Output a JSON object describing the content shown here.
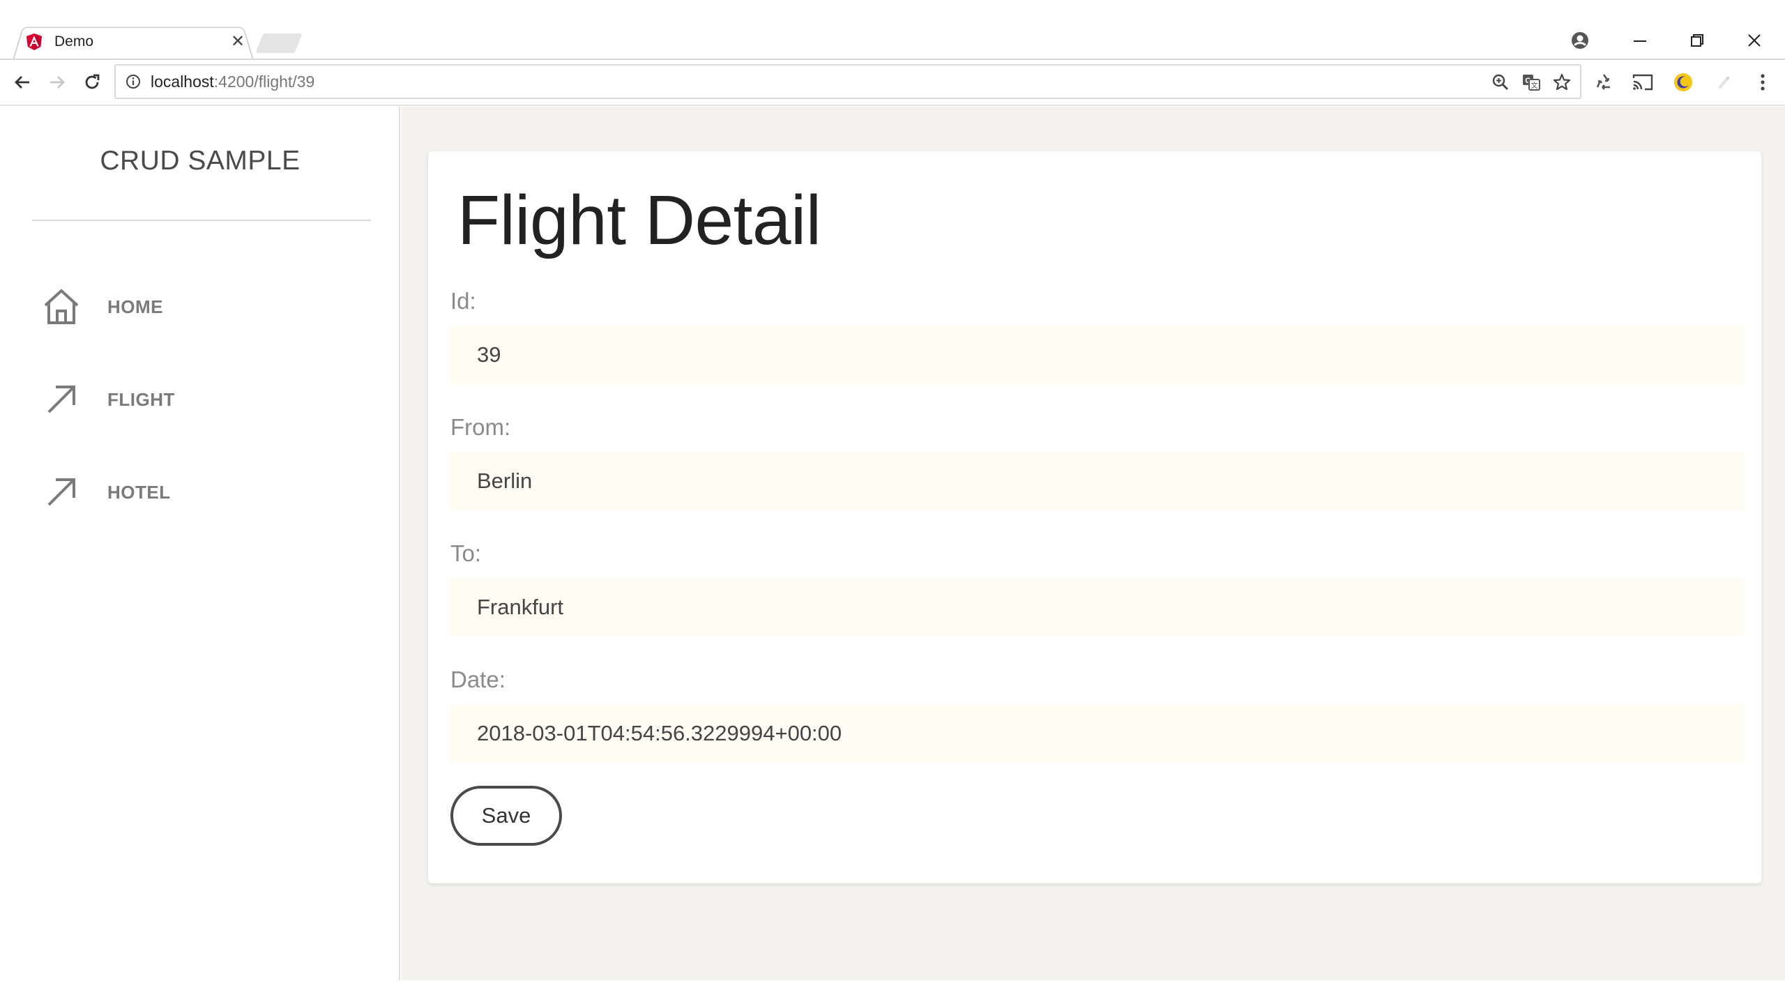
{
  "browser": {
    "tab_title": "Demo",
    "tab_close": "✕",
    "url_host": "localhost",
    "url_path": ":4200/flight/39",
    "extension_accent": "#f5c518"
  },
  "sidebar": {
    "brand": "CRUD SAMPLE",
    "items": [
      {
        "label": "HOME",
        "icon": "home-icon"
      },
      {
        "label": "FLIGHT",
        "icon": "arrow-up-right-icon"
      },
      {
        "label": "HOTEL",
        "icon": "arrow-up-right-icon"
      }
    ]
  },
  "main": {
    "title": "Flight Detail",
    "fields": [
      {
        "label": "Id:",
        "value": "39"
      },
      {
        "label": "From:",
        "value": "Berlin"
      },
      {
        "label": "To:",
        "value": "Frankfurt"
      },
      {
        "label": "Date:",
        "value": "2018-03-01T04:54:56.3229994+00:00"
      }
    ],
    "save_label": "Save"
  },
  "colors": {
    "input_background": "#fffcf4",
    "main_background": "#f3f2ef",
    "angular_red": "#dd0031"
  }
}
